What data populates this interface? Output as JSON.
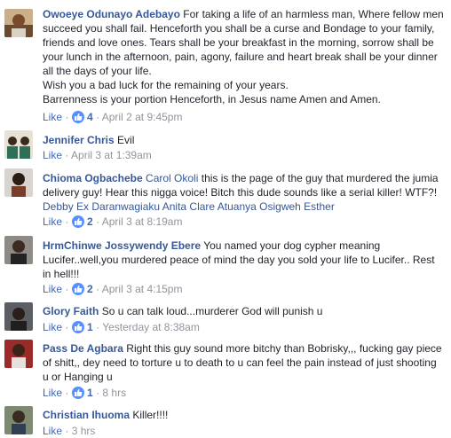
{
  "ui": {
    "like_label": "Like",
    "dot": "·",
    "accent": "#365899",
    "link": "#4267b2",
    "meta_color": "#90949c",
    "reaction_color": "#5890ff",
    "reaction_icon": "thumbs-up-icon"
  },
  "comments": [
    {
      "author": "Owoeye Odunayo Adebayo",
      "text_lines": [
        "For taking a life of an harmless man, Where fellow men succeed you shall fail. Henceforth you shall be a curse and Bondage to your family, friends and love ones. Tears shall be your breakfast in the morning, sorrow shall be your lunch in the afternoon, pain, agony, failure and heart break shall be your dinner all the days of your life.",
        "Wish you a bad luck for the remaining of your years.",
        "Barrenness is your portion Henceforth, in Jesus name Amen and Amen."
      ],
      "reactions": "4",
      "time": "April 2 at 9:45pm"
    },
    {
      "author": "Jennifer Chris",
      "text": "Evil",
      "time": "April 3 at 1:39am"
    },
    {
      "author": "Chioma Ogbachebe",
      "mention_lead": "Carol Okoli",
      "text": "this is the page of the guy that murdered the jumia delivery guy! Hear this nigga voice! Bitch this dude sounds like a serial killer! WTF?!",
      "mentions_tail": "Debby Ex Daranwagiaku Anita Clare Atuanya Osigweh Esther",
      "reactions": "2",
      "time": "April 3 at 8:19am"
    },
    {
      "author": "HrmChinwe Jossywendy Ebere",
      "text": "You named your dog cypher meaning Lucifer..well,you murdered peace of mind the day you sold your life to Lucifer.. Rest in hell!!!",
      "reactions": "2",
      "time": "April 3 at 4:15pm"
    },
    {
      "author": "Glory Faith",
      "text": "So u can talk loud...murderer God will punish u",
      "reactions": "1",
      "time": "Yesterday at 8:38am"
    },
    {
      "author": "Pass De Agbara",
      "text": "Right this guy sound more bitchy than Bobrisky,,, fucking gay piece of shitt,, dey need to torture u to death to u can feel the pain instead of just shooting u or Hanging u",
      "reactions": "1",
      "time": "8 hrs"
    },
    {
      "author": "Christian Ihuoma",
      "text": "Killer!!!!",
      "time": "3 hrs"
    }
  ]
}
